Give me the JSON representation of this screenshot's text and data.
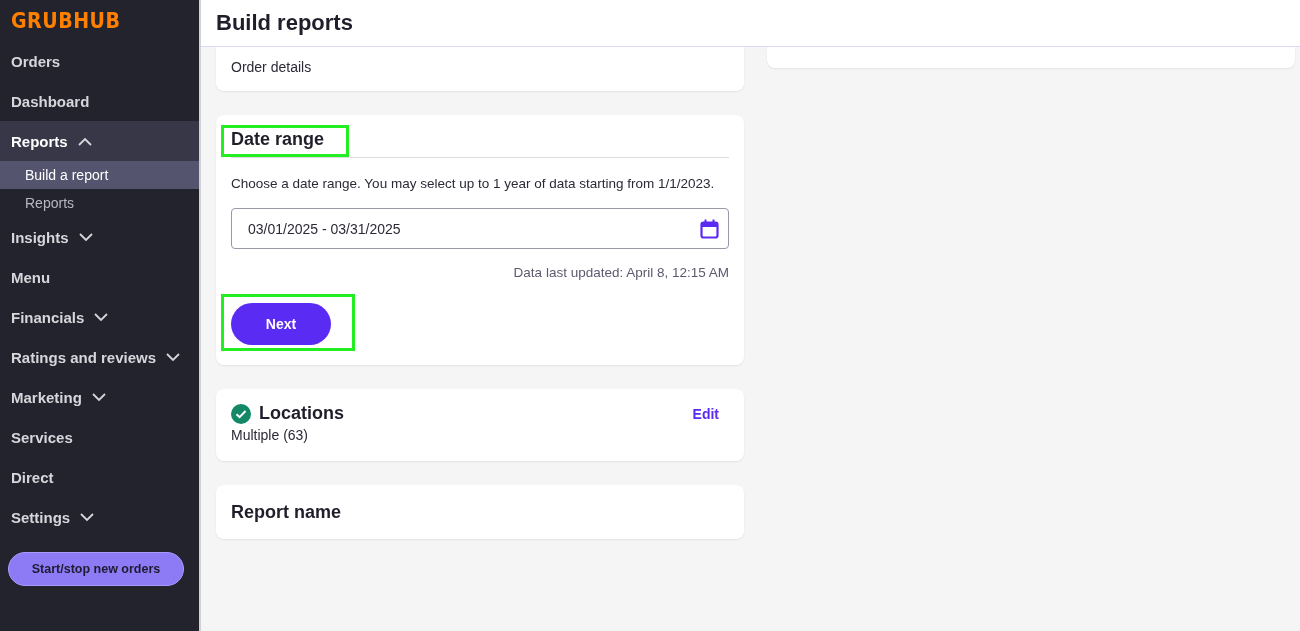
{
  "sidebar": {
    "logo": "GRUBHUB",
    "items": [
      {
        "label": "Orders",
        "selected": false
      },
      {
        "label": "Dashboard",
        "selected": false
      },
      {
        "label": "Reports",
        "selected": true,
        "expanded": true,
        "children": [
          {
            "label": "Build a report",
            "selected": true
          },
          {
            "label": "Reports",
            "selected": false
          }
        ]
      },
      {
        "label": "Insights",
        "selected": false,
        "expanded": false
      },
      {
        "label": "Menu",
        "selected": false
      },
      {
        "label": "Financials",
        "selected": false,
        "expanded": false
      },
      {
        "label": "Ratings and reviews",
        "selected": false,
        "expanded": false
      },
      {
        "label": "Marketing",
        "selected": false,
        "expanded": false
      },
      {
        "label": "Services",
        "selected": false
      },
      {
        "label": "Direct",
        "selected": false
      },
      {
        "label": "Settings",
        "selected": false,
        "expanded": false
      }
    ],
    "button": "Start/stop new orders"
  },
  "header": {
    "title": "Build reports"
  },
  "cards": [
    {
      "kind": "summary",
      "subtitle": "Order details"
    },
    {
      "kind": "date_range",
      "title": "Date range",
      "title_highlighted": true,
      "description": "Choose a date range. You may select up to 1 year of data starting from 1/1/2023.",
      "field_value": "03/01/2025 - 03/31/2025",
      "note": "Data last updated: April 8, 12:15 AM",
      "button": "Next",
      "button_highlighted": true
    },
    {
      "kind": "summary",
      "title": "Locations",
      "subtitle": "Multiple (63)",
      "completed": true,
      "action": "Edit"
    },
    {
      "kind": "name",
      "title": "Report name"
    }
  ]
}
